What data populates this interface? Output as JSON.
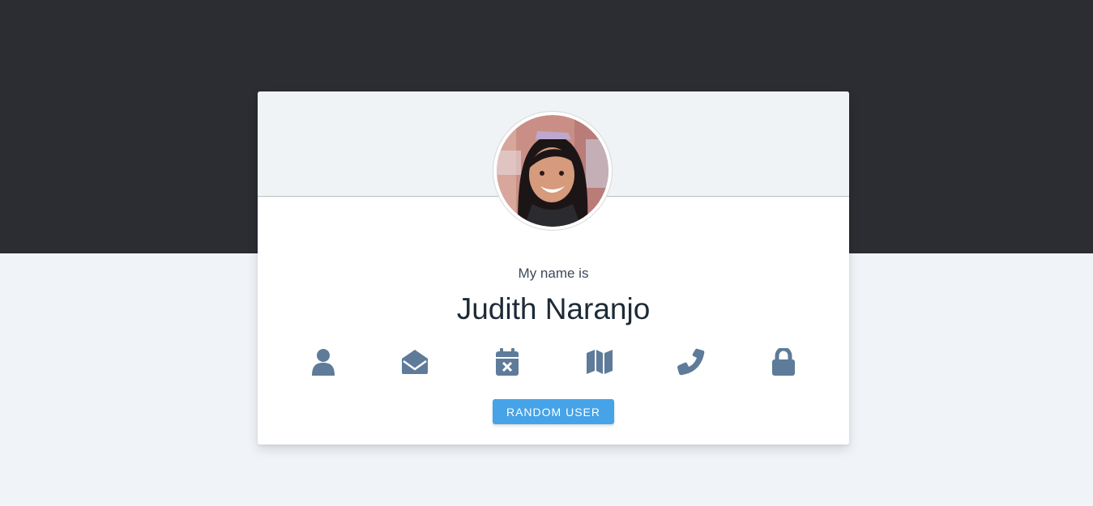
{
  "profile": {
    "label": "My name is",
    "name": "Judith Naranjo",
    "avatar_alt": "user photo"
  },
  "icons": [
    {
      "name": "user-icon"
    },
    {
      "name": "envelope-open-icon"
    },
    {
      "name": "calendar-x-icon"
    },
    {
      "name": "map-icon"
    },
    {
      "name": "phone-icon"
    },
    {
      "name": "lock-icon"
    }
  ],
  "actions": {
    "random_user_label": "RANDOM USER"
  },
  "colors": {
    "top_band": "#2b2d33",
    "background": "#f0f4f8",
    "card": "#ffffff",
    "card_header": "#eff3f6",
    "icon": "#5e7b99",
    "button": "#46a3e8",
    "name_text": "#1d2a36"
  }
}
